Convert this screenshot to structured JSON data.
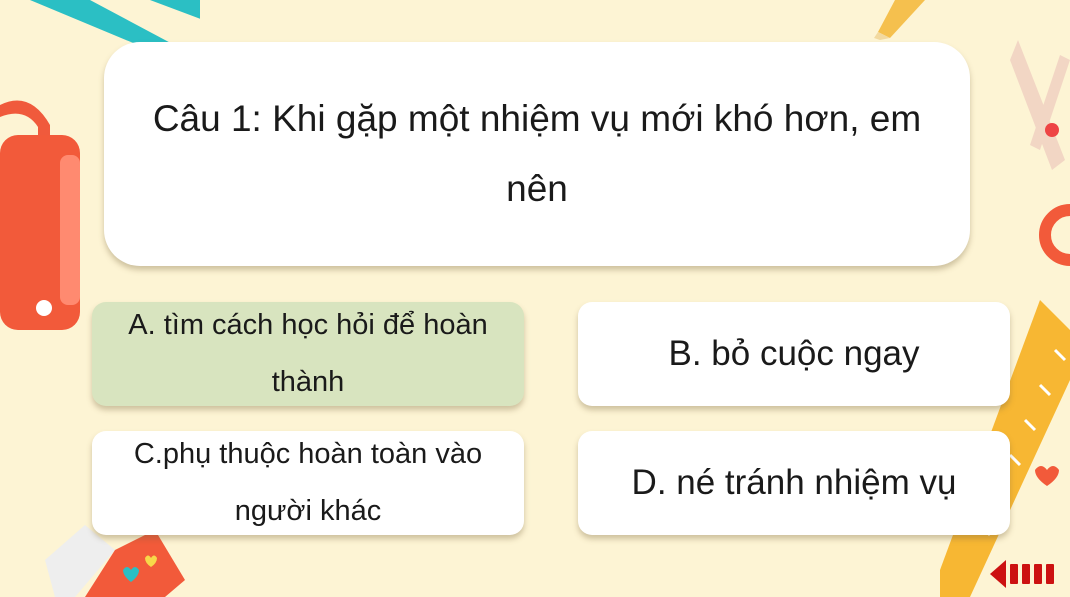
{
  "question": {
    "text": "Câu 1: Khi gặp một nhiệm vụ mới khó hơn, em nên"
  },
  "answers": [
    {
      "text": "A. tìm cách học hỏi để hoàn thành",
      "selected": true
    },
    {
      "text": "B. bỏ cuộc ngay",
      "selected": false
    },
    {
      "text": "C.phụ thuộc hoàn toàn vào người khác",
      "selected": false
    },
    {
      "text": "D. né tránh nhiệm vụ",
      "selected": false
    }
  ],
  "colors": {
    "background": "#fdf4d4",
    "selected_answer": "#d8e4bf",
    "card": "#ffffff",
    "back_arrow": "#cc1111"
  },
  "icons": {
    "back": "back-arrow-icon",
    "decorations": [
      "bag-icon",
      "pencil-icon",
      "scissors-icon",
      "ruler-icon",
      "eraser-icon",
      "teal-stripe-icon"
    ]
  }
}
